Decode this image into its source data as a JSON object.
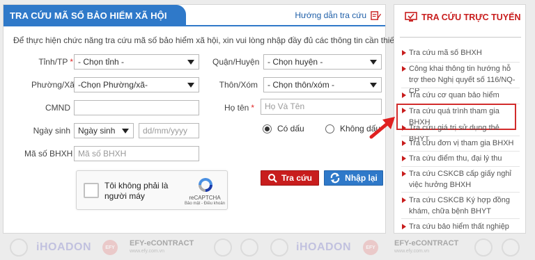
{
  "main": {
    "title": "TRA CỨU MÃ SỐ BẢO HIỂM XÃ HỘI",
    "guide_link": "Hướng dẫn tra cứu",
    "intro": "Để thực hiện chức năng tra cứu mã số bảo hiểm xã hội, xin vui lòng nhập đầy đủ các thông tin cần thiết."
  },
  "form": {
    "province_label": "Tỉnh/TP",
    "required_mark": "*",
    "province_value": "- Chọn tỉnh -",
    "district_label": "Quận/Huyện",
    "district_value": "- Chọn huyện -",
    "ward_label": "Phường/Xã",
    "ward_value": "-Chọn Phường/xã-",
    "village_label": "Thôn/Xóm",
    "village_value": "- Chọn thôn/xóm -",
    "id_label": "CMND",
    "id_value": "",
    "name_label": "Họ tên",
    "name_placeholder": "Họ Và Tên",
    "dob_label": "Ngày sinh",
    "dob_type_value": "Ngày sinh",
    "dob_placeholder": "dd/mm/yyyy",
    "diacritics_yes": "Có dấu",
    "diacritics_no": "Không dấu",
    "diacritics_selected": "yes",
    "bhxh_label": "Mã số BHXH",
    "bhxh_placeholder": "Mã số BHXH"
  },
  "captcha": {
    "text": "Tôi không phải là người máy",
    "brand": "reCAPTCHA",
    "links": "Bảo mật - Điều khoản"
  },
  "buttons": {
    "search": "Tra cứu",
    "reset": "Nhập lại"
  },
  "side": {
    "title": "TRA CỨU TRỰC TUYẾN",
    "items": [
      "Tra cứu mã số BHXH",
      "Công khai thông tin hướng hỗ trợ theo Nghị quyết số 116/NQ-CP",
      "Tra cứu cơ quan bảo hiểm",
      "Tra cứu quá trình tham gia BHXH",
      "Tra cứu giá trị sử dụng thẻ BHYT",
      "Tra cứu đơn vị tham gia BHXH",
      "Tra cứu điểm thu, đại lý thu",
      "Tra cứu CSKCB cấp giấy nghỉ việc hưởng BHXH",
      "Tra cứu CSKCB Ký hợp đồng khám, chữa bệnh BHYT",
      "Tra cứu bảo hiểm thất nghiệp"
    ],
    "highlighted_index": 3
  },
  "footer": {
    "logo_ihoadon": "iHOADON",
    "logo_efy": "EFY",
    "logo_econtract": "EFY-eCONTRACT",
    "logo_econtract_sub": "www.efy.com.vn"
  },
  "colors": {
    "accent_blue": "#2f79c9",
    "accent_red": "#c81d1d"
  }
}
